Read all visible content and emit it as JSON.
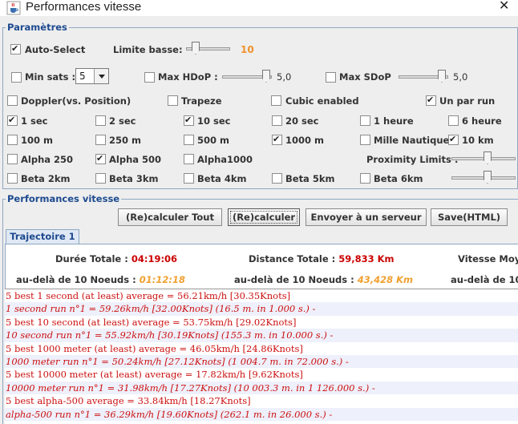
{
  "window": {
    "title": "Performances vitesse",
    "icon": "java-cup-icon"
  },
  "params": {
    "legend": "Paramètres",
    "auto_select": {
      "label": "Auto-Select",
      "checked": true
    },
    "limite_basse": {
      "label": "Limite basse:",
      "value": "10"
    },
    "min_sats": {
      "label": "Min sats :",
      "checked": false,
      "value": "5"
    },
    "max_hdop": {
      "label": "Max HDoP :",
      "checked": false,
      "value": "5,0"
    },
    "max_sdop": {
      "label": "Max SDoP",
      "checked": false,
      "value": "5,0"
    },
    "row3": [
      {
        "label": "Doppler(vs. Position)",
        "checked": false
      },
      {
        "label": "Trapeze",
        "checked": false
      },
      {
        "label": "Cubic enabled",
        "checked": false
      },
      {
        "label": "Un par run",
        "checked": true
      }
    ],
    "row4": [
      {
        "label": "1 sec",
        "checked": true
      },
      {
        "label": "2 sec",
        "checked": false
      },
      {
        "label": "10 sec",
        "checked": true
      },
      {
        "label": "20 sec",
        "checked": false
      },
      {
        "label": "1 heure",
        "checked": false
      },
      {
        "label": "6 heure",
        "checked": false
      }
    ],
    "row5": [
      {
        "label": "100 m",
        "checked": false
      },
      {
        "label": "250 m",
        "checked": false
      },
      {
        "label": "500 m",
        "checked": false
      },
      {
        "label": "1000 m",
        "checked": true
      },
      {
        "label": "Mille Nautique",
        "checked": false
      },
      {
        "label": "10 km",
        "checked": true
      }
    ],
    "row6": [
      {
        "label": "Alpha 250",
        "checked": false
      },
      {
        "label": "Alpha 500",
        "checked": true
      },
      {
        "label": "Alpha1000",
        "checked": false
      }
    ],
    "proximity_label": "Proximity Limits :",
    "row7": [
      {
        "label": "Beta 2km",
        "checked": false
      },
      {
        "label": "Beta 3km",
        "checked": false
      },
      {
        "label": "Beta 4km",
        "checked": false
      },
      {
        "label": "Beta 5km",
        "checked": false
      },
      {
        "label": "Beta 6km",
        "checked": false
      }
    ]
  },
  "perf": {
    "legend": "Performances vitesse",
    "buttons": {
      "recalc_all": "(Re)calculer Tout",
      "recalc": "(Re)calculer",
      "send": "Envoyer à un serveur",
      "save": "Save(HTML)"
    },
    "tab": "Trajectoire 1",
    "stats": {
      "duree_label": "Durée Totale :",
      "duree_value": "04:19:06",
      "distance_label": "Distance Totale :",
      "distance_value": "59,833 Km",
      "vitesse_label": "Vitesse Moy.",
      "au_dela_1_label": "au-delà de",
      "au_dela_1_nds": "10 Noeuds :",
      "au_dela_1_value": "01:12:18",
      "au_dela_2_label": "au-delà de",
      "au_dela_2_nds": "10 Noeuds :",
      "au_dela_2_value": "43,428 Km",
      "au_dela_3_label": "au-delà de",
      "au_dela_3_nds": "10 N"
    },
    "log": [
      "5 best 1 second (at least) average = 56.21km/h [30.35Knots]",
      "1 second run n°1 = 59.26km/h [32.00Knots] (16.5 m. in 1.000 s.) -",
      "5 best 10 second (at least) average = 53.75km/h [29.02Knots]",
      "10 second run n°1 = 55.92km/h [30.19Knots] (155.3 m. in 10.000 s.) -",
      "5 best 1000 meter (at least) average = 46.05km/h [24.86Knots]",
      "1000 meter run n°1 = 50.24km/h [27.12Knots] (1 004.7 m. in 72.000 s.) -",
      "5 best 10000 meter (at least) average = 17.82km/h [9.62Knots]",
      "10000 meter run n°1 = 31.98km/h [17.27Knots] (10 003.3 m. in 1 126.000 s.) -",
      "5 best alpha-500 average = 33.84km/h [18.27Knots]",
      "alpha-500 run n°1 = 36.29km/h [19.60Knots] (262.1 m. in 26.000 s.) -"
    ]
  }
}
